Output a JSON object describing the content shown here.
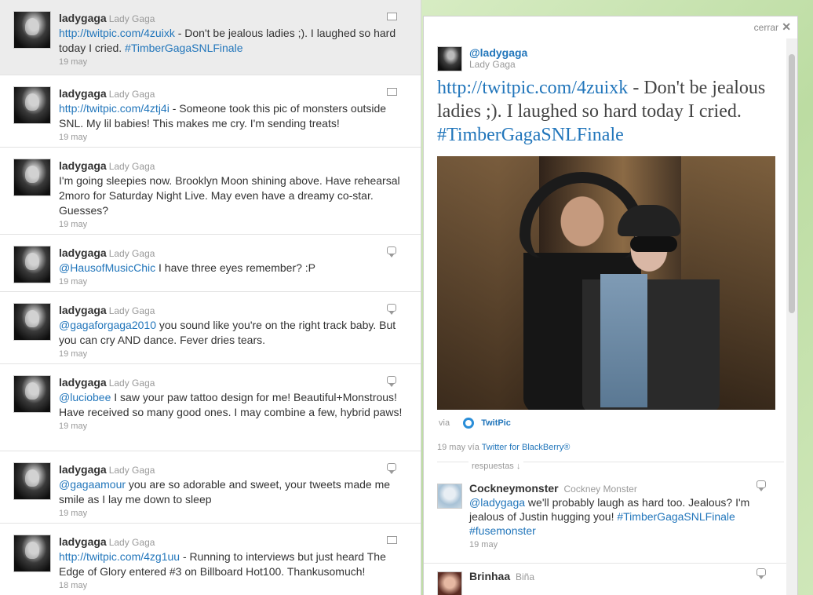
{
  "timeline": {
    "tweets": [
      {
        "user": "ladygaga",
        "realname": "Lady Gaga",
        "link": "http://twitpic.com/4zuixk",
        "text": " - Don't be jealous ladies ;). I laughed so hard today I cried. ",
        "hashtag": "#TimberGagaSNLFinale",
        "date": "19 may",
        "icon": "media-icon"
      },
      {
        "user": "ladygaga",
        "realname": "Lady Gaga",
        "link": "http://twitpic.com/4ztj4i",
        "text": " - Someone took this pic of monsters outside SNL. My lil babies! This makes me cry. I'm sending treats!",
        "date": "19 may",
        "icon": "media-icon"
      },
      {
        "user": "ladygaga",
        "realname": "Lady Gaga",
        "text": "I'm going sleepies now. Brooklyn Moon shining above. Have rehearsal 2moro for Saturday Night Live. May even have a dreamy co-star. Guesses?",
        "date": "19 may"
      },
      {
        "user": "ladygaga",
        "realname": "Lady Gaga",
        "mention": "@HausofMusicChic",
        "text": " I have three eyes remember? :P",
        "date": "19 may",
        "icon": "reply-icon"
      },
      {
        "user": "ladygaga",
        "realname": "Lady Gaga",
        "mention": "@gagaforgaga2010",
        "text": " you sound like you're on the right track baby. But you can cry AND dance. Fever dries tears.",
        "date": "19 may",
        "icon": "reply-icon"
      },
      {
        "user": "ladygaga",
        "realname": "Lady Gaga",
        "mention": "@luciobee",
        "text": " I saw your paw tattoo design for me! Beautiful+Monstrous! Have received so many good ones. I may combine a few, hybrid paws!",
        "date": "19 may",
        "icon": "reply-icon"
      },
      {
        "user": "ladygaga",
        "realname": "Lady Gaga",
        "mention": "@gagaamour",
        "text": " you are so adorable and sweet, your tweets made me smile as I lay me down to sleep",
        "date": "19 may",
        "icon": "reply-icon"
      },
      {
        "user": "ladygaga",
        "realname": "Lady Gaga",
        "link": "http://twitpic.com/4zg1uu",
        "text": " - Running to interviews but just heard The Edge of Glory entered #3 on Billboard Hot100. Thankusomuch!",
        "date": "18 may",
        "icon": "media-icon"
      }
    ]
  },
  "detail": {
    "close_label": "cerrar",
    "close_icon": "✕",
    "user": "@ladygaga",
    "realname": "Lady Gaga",
    "link": "http://twitpic.com/4zuixk",
    "text": " - Don't be jealous ladies ;). I laughed so hard today I cried. ",
    "hashtag": "#TimberGagaSNLFinale",
    "via_label": "via",
    "via_service": "TwitPic",
    "date": "19 may",
    "via_prefix": "vía",
    "client": "Twitter for BlackBerry®",
    "replies_label": "respuestas ↓",
    "replies": [
      {
        "user": "Cockneymonster",
        "realname": "Cockney Monster",
        "mention": "@ladygaga",
        "text": " we'll probably laugh as hard too. Jealous? I'm jealous of Justin hugging you! ",
        "hashtags": "#TimberGagaSNLFinale #fusemonster",
        "date": "19 may"
      },
      {
        "user": "Brinhaa",
        "realname": "Biña"
      }
    ]
  },
  "colors": {
    "link": "#2276bb",
    "background": "#cde6b8"
  }
}
